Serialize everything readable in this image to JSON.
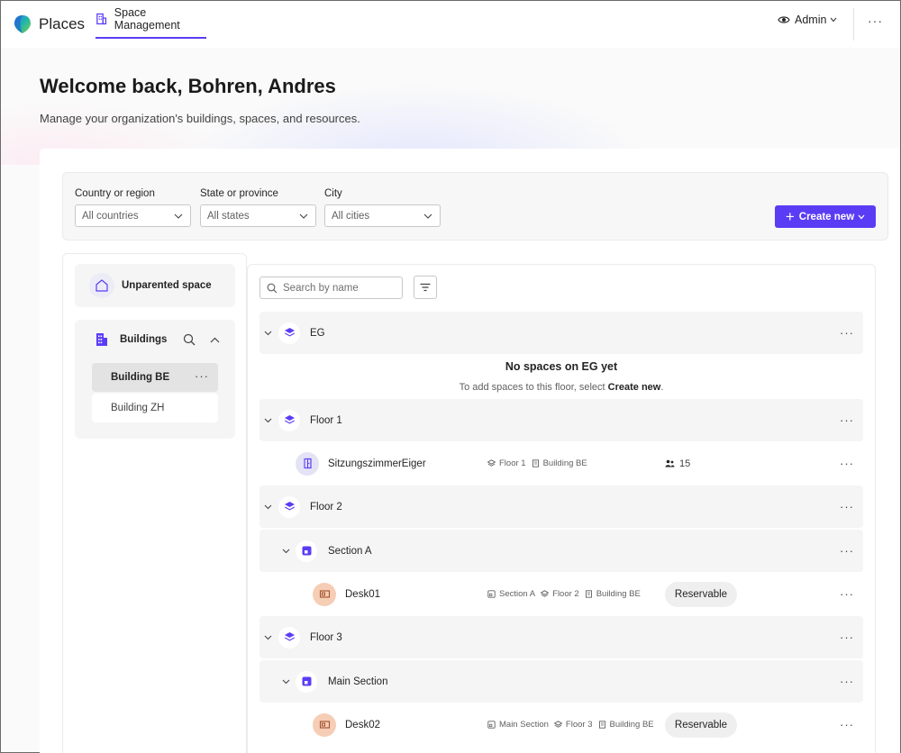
{
  "app": {
    "name": "Places"
  },
  "nav": {
    "tab_label": "Space Management"
  },
  "user": {
    "role_label": "Admin"
  },
  "hero": {
    "title": "Welcome back, Bohren, Andres",
    "subtitle": "Manage your organization's buildings, spaces, and resources."
  },
  "filters": {
    "country": {
      "label": "Country or region",
      "value": "All countries"
    },
    "state": {
      "label": "State or province",
      "value": "All states"
    },
    "city": {
      "label": "City",
      "value": "All cities"
    },
    "create_label": "Create new"
  },
  "left": {
    "unparented_label": "Unparented space",
    "buildings_label": "Buildings",
    "buildings": [
      {
        "name": "Building BE",
        "selected": true
      },
      {
        "name": "Building ZH",
        "selected": false
      }
    ]
  },
  "right": {
    "search_placeholder": "Search by name",
    "empty": {
      "title": "No spaces on EG yet",
      "sub_prefix": "To add spaces to this floor, select ",
      "sub_action": "Create new",
      "sub_suffix": "."
    },
    "rows": {
      "eg": {
        "label": "EG"
      },
      "floor1": {
        "label": "Floor 1"
      },
      "room1": {
        "label": "SitzungszimmerEiger",
        "crumb_floor": "Floor 1",
        "crumb_building": "Building BE",
        "capacity": "15"
      },
      "floor2": {
        "label": "Floor 2"
      },
      "sectionA": {
        "label": "Section A"
      },
      "desk01": {
        "label": "Desk01",
        "crumb_section": "Section A",
        "crumb_floor": "Floor 2",
        "crumb_building": "Building BE",
        "status": "Reservable"
      },
      "floor3": {
        "label": "Floor 3"
      },
      "mainSection": {
        "label": "Main Section"
      },
      "desk02": {
        "label": "Desk02",
        "crumb_section": "Main Section",
        "crumb_floor": "Floor 3",
        "crumb_building": "Building BE",
        "status": "Reservable"
      }
    }
  },
  "colors": {
    "accent": "#5b3cf5",
    "desk_icon_bg": "#f6cdb5",
    "room_icon_bg": "#e4e2f5"
  }
}
